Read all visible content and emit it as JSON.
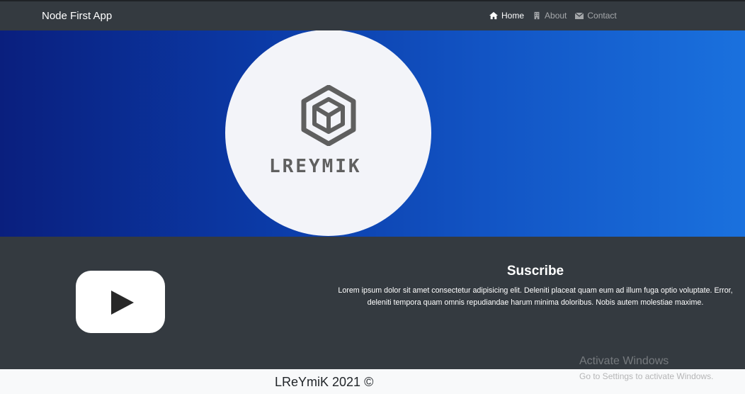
{
  "navbar": {
    "brand": "Node First App",
    "items": [
      {
        "label": "Home",
        "icon": "home-icon",
        "active": true
      },
      {
        "label": "About",
        "icon": "building-icon",
        "active": false
      },
      {
        "label": "Contact",
        "icon": "envelope-icon",
        "active": false
      }
    ]
  },
  "hero": {
    "logo_text": "LREYMIK",
    "logo_icon": "hexagon-cube-icon"
  },
  "subscribe": {
    "icon": "youtube-play-icon",
    "title": "Suscribe",
    "text": "Lorem ipsum dolor sit amet consectetur adipisicing elit. Deleniti placeat quam eum ad illum fuga optio voluptate. Error, deleniti tempora quam omnis repudiandae harum minima doloribus. Nobis autem molestiae maxime."
  },
  "footer": {
    "text": "LReYmiK 2021 ©"
  },
  "watermark": {
    "title": "Activate Windows",
    "subtitle": "Go to Settings to activate Windows."
  },
  "colors": {
    "navbar_bg": "#343a40",
    "hero_gradient_start": "#0a1f7e",
    "hero_gradient_end": "#1a71de",
    "band_bg": "#343a40",
    "footer_bg": "#f8f9fa"
  }
}
